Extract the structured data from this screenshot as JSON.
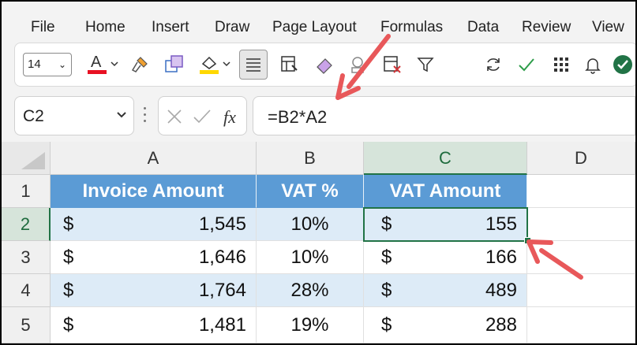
{
  "menu": {
    "items": [
      "File",
      "Home",
      "Insert",
      "Draw",
      "Page Layout",
      "Formulas",
      "Data",
      "Review",
      "View"
    ]
  },
  "toolbar": {
    "font_size": "14",
    "font_color": "#e81123",
    "highlight_color": "#ffd800",
    "accent": "#217346",
    "icons": [
      "font-color-icon",
      "format-painter-icon",
      "cell-styles-icon",
      "fill-color-icon",
      "align-center-icon",
      "format-cells-icon",
      "eraser-icon",
      "clear-formats-icon",
      "delete-cells-icon",
      "filter-icon",
      "refresh-icon",
      "checkmark-icon",
      "grid-icon",
      "bell-icon",
      "done-icon"
    ]
  },
  "formula_bar": {
    "name_box": "C2",
    "formula": "=B2*A2"
  },
  "grid": {
    "columns": [
      "A",
      "B",
      "C",
      "D"
    ],
    "rows": [
      "1",
      "2",
      "3",
      "4",
      "5"
    ],
    "header_row": [
      "Invoice Amount",
      "VAT %",
      "VAT Amount"
    ],
    "data": [
      {
        "currency_a": "$",
        "amount": "1,545",
        "vat": "10%",
        "currency_c": "$",
        "vat_amount": "155"
      },
      {
        "currency_a": "$",
        "amount": "1,646",
        "vat": "10%",
        "currency_c": "$",
        "vat_amount": "166"
      },
      {
        "currency_a": "$",
        "amount": "1,764",
        "vat": "28%",
        "currency_c": "$",
        "vat_amount": "489"
      },
      {
        "currency_a": "$",
        "amount": "1,481",
        "vat": "19%",
        "currency_c": "$",
        "vat_amount": "288"
      }
    ],
    "header_fill": "#5b9bd5",
    "band_fill": "#ddebf7",
    "arrow_color": "#e8585a"
  }
}
